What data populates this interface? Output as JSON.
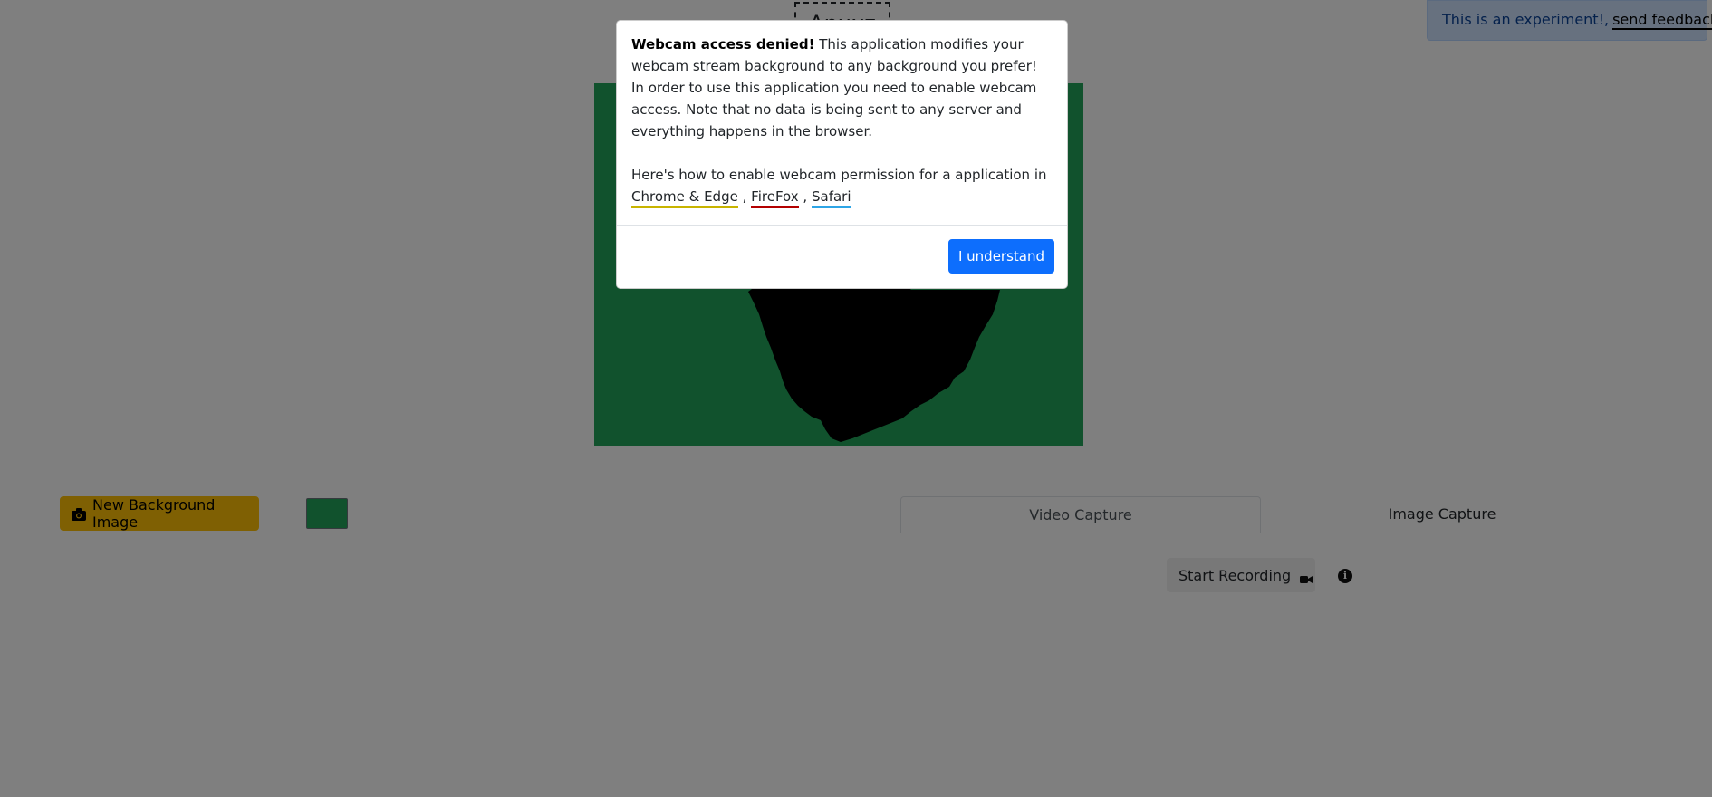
{
  "header": {
    "logo_text": "Anuxz",
    "feedback_text": "This is an experiment!,",
    "feedback_link": "send feedback"
  },
  "controls": {
    "background_button_label": "New Background Image",
    "background_color": "#22a55b"
  },
  "tabs": [
    {
      "label": "Video Capture",
      "active": true
    },
    {
      "label": "Image Capture",
      "active": false
    }
  ],
  "recording": {
    "start_label": "Start Recording"
  },
  "modal": {
    "title": "Webcam access denied!",
    "message": "This application modifies your webcam stream background to any background you prefer! In order to use this application you need to enable webcam access. Note that no data is being sent to any server and everything happens in the browser.",
    "help_intro": "Here's how to enable webcam permission for a application in",
    "links": [
      {
        "label": "Chrome & Edge",
        "color": "#c8b400"
      },
      {
        "label": "FireFox",
        "color": "#b30000"
      },
      {
        "label": "Safari",
        "color": "#2ea5e6"
      }
    ],
    "separator": ",",
    "confirm_label": "I understand"
  },
  "colors": {
    "primary": "#0d6efd",
    "warning": "#ffc107",
    "preview_background": "#22a55b",
    "feedback_background": "#cfe2ff"
  },
  "icons": {
    "background_button": "camera-icon",
    "record": "video-camera-icon",
    "info": "info-icon"
  }
}
